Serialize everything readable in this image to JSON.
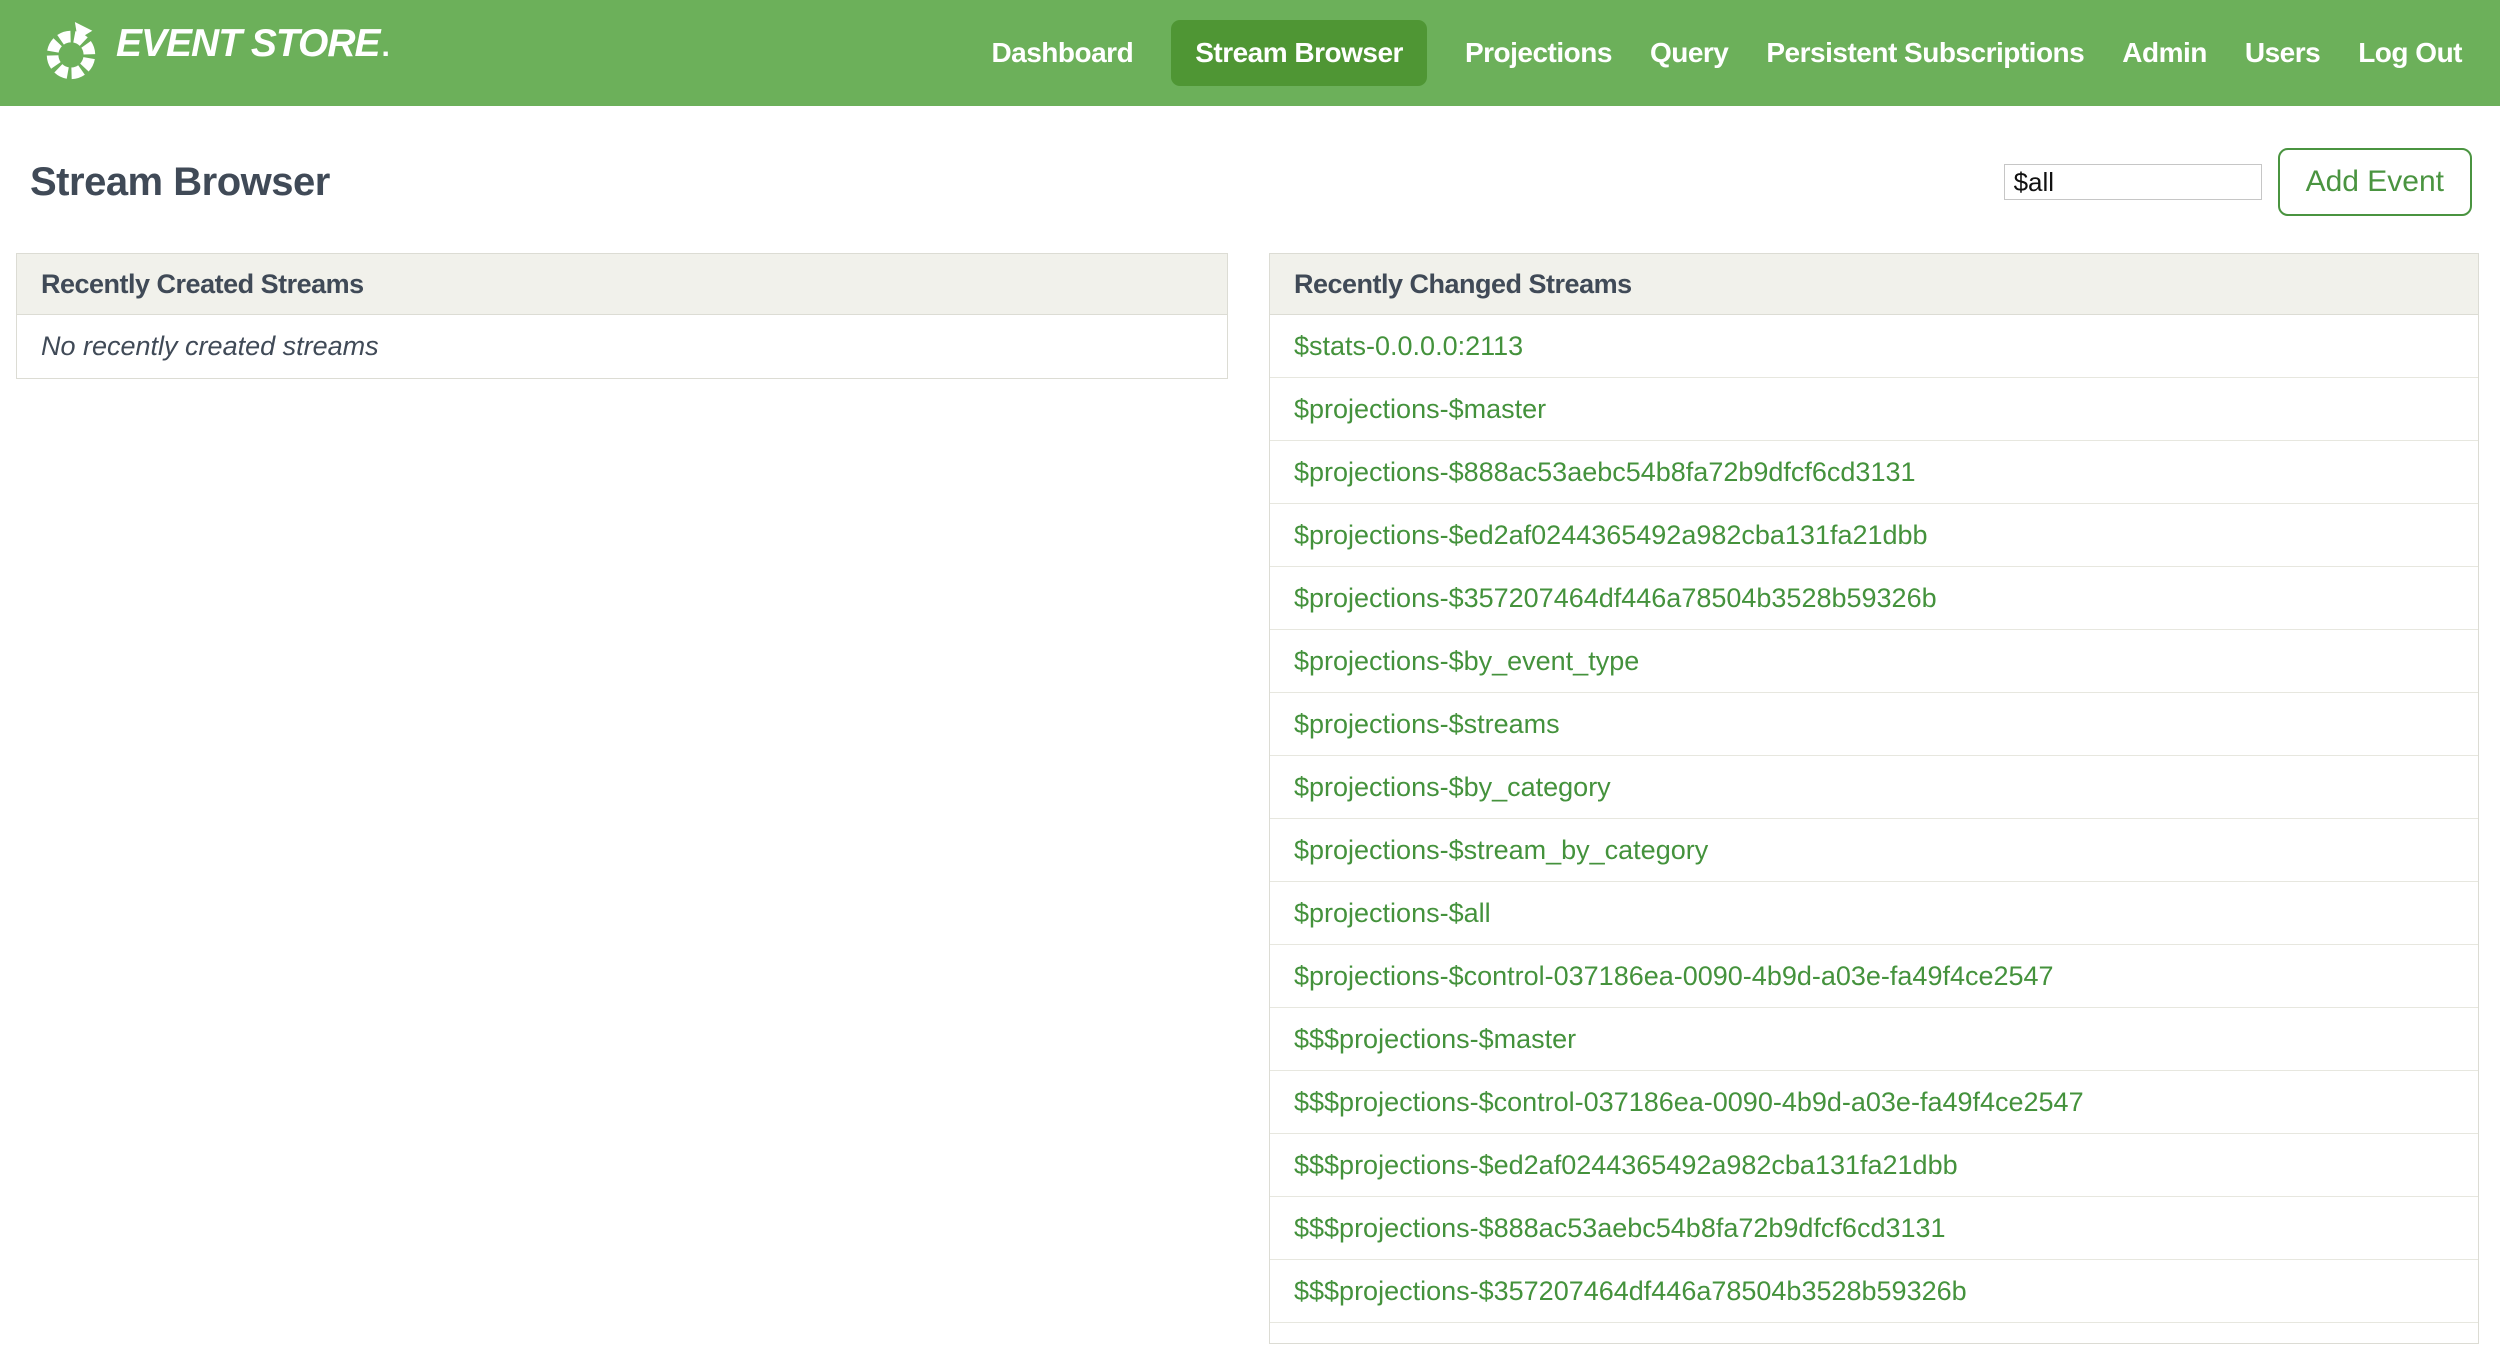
{
  "header": {
    "logo": {
      "brand": "EVENT STORE",
      "suffix": "."
    },
    "nav": [
      {
        "label": "Dashboard",
        "active": false
      },
      {
        "label": "Stream Browser",
        "active": true
      },
      {
        "label": "Projections",
        "active": false
      },
      {
        "label": "Query",
        "active": false
      },
      {
        "label": "Persistent Subscriptions",
        "active": false
      },
      {
        "label": "Admin",
        "active": false
      },
      {
        "label": "Users",
        "active": false
      },
      {
        "label": "Log Out",
        "active": false
      }
    ]
  },
  "page": {
    "title": "Stream Browser",
    "stream_input_value": "$all",
    "add_event_label": "Add Event"
  },
  "panels": {
    "created": {
      "title": "Recently Created Streams",
      "empty_message": "No recently created streams"
    },
    "changed": {
      "title": "Recently Changed Streams",
      "streams": [
        "$stats-0.0.0.0:2113",
        "$projections-$master",
        "$projections-$888ac53aebc54b8fa72b9dfcf6cd3131",
        "$projections-$ed2af0244365492a982cba131fa21dbb",
        "$projections-$357207464df446a78504b3528b59326b",
        "$projections-$by_event_type",
        "$projections-$streams",
        "$projections-$by_category",
        "$projections-$stream_by_category",
        "$projections-$all",
        "$projections-$control-037186ea-0090-4b9d-a03e-fa49f4ce2547",
        "$$$projections-$master",
        "$$$projections-$control-037186ea-0090-4b9d-a03e-fa49f4ce2547",
        "$$$projections-$ed2af0244365492a982cba131fa21dbb",
        "$$$projections-$888ac53aebc54b8fa72b9dfcf6cd3131",
        "$$$projections-$357207464df446a78504b3528b59326b"
      ]
    }
  },
  "colors": {
    "header_green": "#6cb05a",
    "active_nav_green": "#4f9634",
    "link_green": "#44923c",
    "heading_dark": "#404a57",
    "panel_header_bg": "#f1f1eb",
    "panel_border": "#dcdcd4"
  }
}
